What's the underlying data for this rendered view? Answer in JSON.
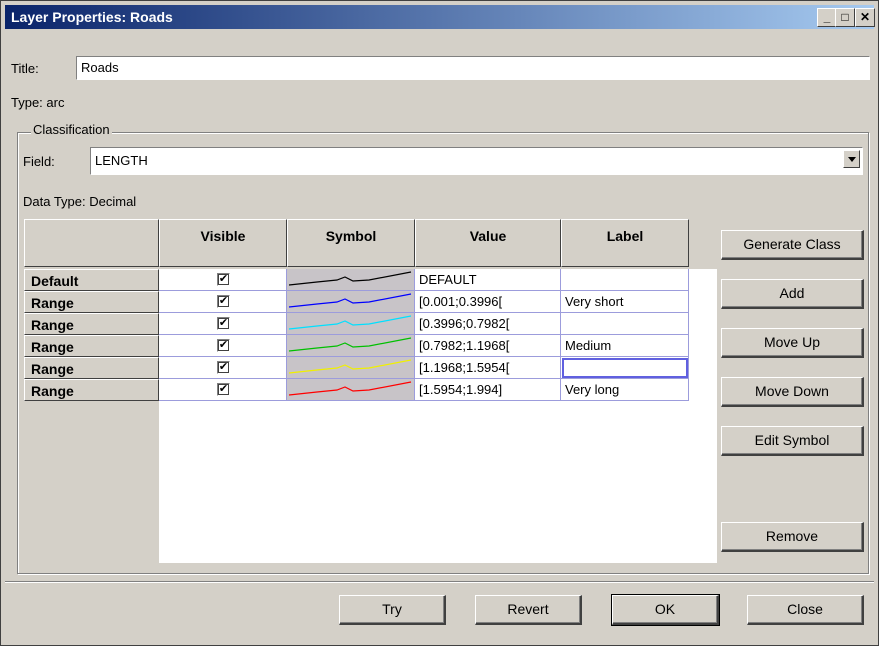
{
  "window": {
    "title": "Layer Properties: Roads",
    "minimize": "_",
    "maximize": "□",
    "close": "✕"
  },
  "title_field": {
    "label": "Title:",
    "value": "Roads"
  },
  "type_text": "Type: arc",
  "classification": {
    "legend": "Classification",
    "field_label": "Field:",
    "field_value": "LENGTH",
    "data_type": "Data Type: Decimal"
  },
  "grid": {
    "columns": [
      "Visible",
      "Symbol",
      "Value",
      "Label"
    ],
    "rows": [
      {
        "header": "Default",
        "visible": true,
        "value": "DEFAULT",
        "label": "",
        "color": "#000000"
      },
      {
        "header": "Range",
        "visible": true,
        "value": "[0.001;0.3996[",
        "label": "Very short",
        "color": "#0000ff"
      },
      {
        "header": "Range",
        "visible": true,
        "value": "[0.3996;0.7982[",
        "label": "",
        "color": "#00e0ff"
      },
      {
        "header": "Range",
        "visible": true,
        "value": "[0.7982;1.1968[",
        "label": "Medium",
        "color": "#00c000"
      },
      {
        "header": "Range",
        "visible": true,
        "value": "[1.1968;1.5954[",
        "label": "",
        "color": "#f0f000"
      },
      {
        "header": "Range",
        "visible": true,
        "value": "[1.5954;1.994]",
        "label": "Very long",
        "color": "#ff0000"
      }
    ]
  },
  "side_buttons": {
    "generate": "Generate Class",
    "add": "Add",
    "move_up": "Move Up",
    "move_down": "Move Down",
    "edit_symbol": "Edit Symbol",
    "remove": "Remove"
  },
  "bottom_buttons": {
    "try": "Try",
    "revert": "Revert",
    "ok": "OK",
    "close": "Close"
  },
  "check_glyph": "✔"
}
